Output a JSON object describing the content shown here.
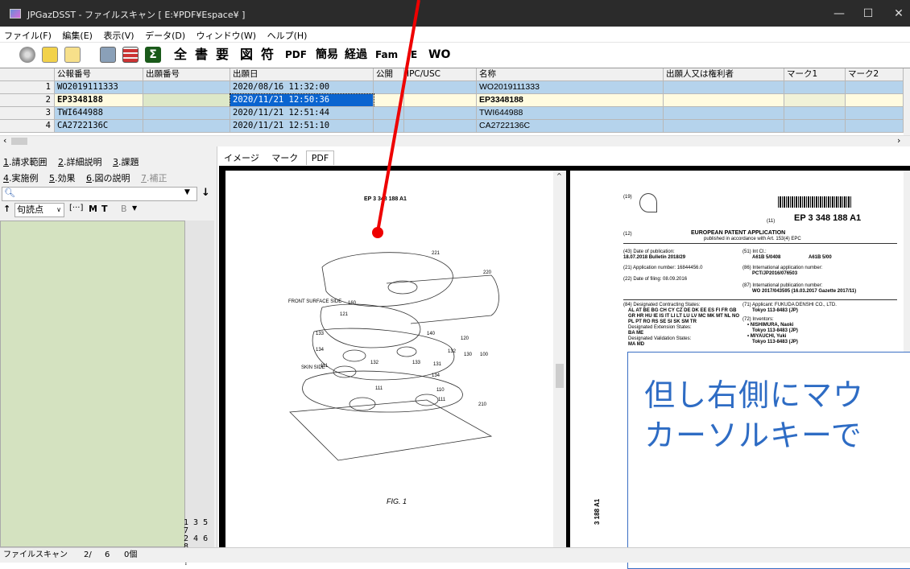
{
  "window": {
    "title": "JPGazDSST - ファイルスキャン [ E:¥PDF¥Espace¥ ]",
    "controls": [
      "—",
      "☐",
      "✕"
    ]
  },
  "menu": [
    "ファイル(F)",
    "編集(E)",
    "表示(V)",
    "データ(D)",
    "ウィンドウ(W)",
    "ヘルプ(H)"
  ],
  "toolbar": {
    "labels": [
      "全",
      "書",
      "要",
      "図",
      "符",
      "PDF",
      "簡易",
      "経過",
      "Fam",
      "E",
      "WO"
    ]
  },
  "grid": {
    "headers": [
      "",
      "公報番号",
      "出願番号",
      "出願日",
      "公開",
      "IPC/USC",
      "名称",
      "出願人又は権利者",
      "マーク1",
      "マーク2"
    ],
    "rows": [
      {
        "num": "1",
        "pub": "WO2019111333",
        "app": "",
        "date": "2020/08/16 11:32:00",
        "name": "WO2019111333"
      },
      {
        "num": "2",
        "pub": "EP3348188",
        "app": "",
        "date": "2020/11/21 12:50:36",
        "name": "EP3348188"
      },
      {
        "num": "3",
        "pub": "TWI644988",
        "app": "",
        "date": "2020/11/21 12:51:44",
        "name": "TWI644988"
      },
      {
        "num": "4",
        "pub": "CA2722136C",
        "app": "",
        "date": "2020/11/21 12:51:10",
        "name": "CA2722136C"
      }
    ]
  },
  "left": {
    "tabs_row1": [
      {
        "n": "1",
        "t": ".請求範囲"
      },
      {
        "n": "2",
        "t": ".詳細説明"
      },
      {
        "n": "3",
        "t": ".課題"
      }
    ],
    "tabs_row2": [
      {
        "n": "4",
        "t": ".実施例"
      },
      {
        "n": "5",
        "t": ".効果"
      },
      {
        "n": "6",
        "t": ".図の説明"
      },
      {
        "n": "7",
        "t": ".補正"
      }
    ],
    "punct_label": "句読点",
    "tool_labels": [
      "M",
      "T",
      "B"
    ],
    "nums": [
      "1 3 5 7",
      "2 4 6 8",
      "on  off ?"
    ]
  },
  "viewer_tabs": [
    "イメージ",
    "マーク",
    "PDF"
  ],
  "page1": {
    "header": "EP 3 348 188 A1",
    "labels": [
      "221",
      "220",
      "FRONT SURFACE SIDE",
      "160",
      "121",
      "140",
      "120",
      "133",
      "134",
      "132",
      "133",
      "131",
      "132",
      "130",
      "100",
      "SKIN SIDE",
      "111",
      "134",
      "111",
      "110",
      "111",
      "210"
    ],
    "fig": "FIG. 1"
  },
  "page2": {
    "num19": "(19)",
    "num11": "(11)",
    "pubno": "EP 3 348 188 A1",
    "num12": "(12)",
    "kind": "EUROPEAN PATENT APPLICATION",
    "kind_sub": "published in accordance with Art. 153(4) EPC",
    "left_col": [
      "(43) Date of publication:",
      "18.07.2018  Bulletin 2018/29",
      "(21) Application number: 16844456.0",
      "(22) Date of filing: 08.09.2016",
      "(84) Designated Contracting States:",
      "AL AT BE BG CH CY CZ DE DK EE ES FI FR GB",
      "GR HR HU IE IS IT LI LT LU LV MC MK MT NL NO",
      "PL PT RO RS SE SI SK SM TR",
      "Designated Extension States:",
      "BA ME",
      "Designated Validation States:",
      "MA MD"
    ],
    "right_col": [
      "(51) Int Cl.:",
      "A61B 5/0408",
      "A61B 5/00",
      "(86) International application number:",
      "PCT/JP2016/076503",
      "(87) International publication number:",
      "WO 2017/043595 (16.03.2017 Gazette 2017/11)",
      "(71) Applicant: FUKUDA DENSHI CO., LTD.",
      "Tokyo 113-8483 (JP)",
      "(72) Inventors:",
      "• NISHIMURA, Naoki",
      "Tokyo 113-8483 (JP)",
      "• MIYAUCHI, Yuki",
      "Tokyo 113-8483 (JP)"
    ],
    "side": "3 188 A1"
  },
  "callout": {
    "line1": "但し右側にマウ",
    "line2": "カーソルキーで"
  },
  "status": {
    "label": "ファイルスキャン",
    "pos": "2/",
    "total": "6",
    "count": "0個"
  },
  "colors": {
    "titlebar": "#2b2b2b",
    "row_selected": "#b5d3ec",
    "row_current": "#fffbe0",
    "selected_cell": "#0a64d0",
    "notes": "#d4e2c0",
    "callout_text": "#2e6cc4",
    "pointer": "#e00000"
  }
}
